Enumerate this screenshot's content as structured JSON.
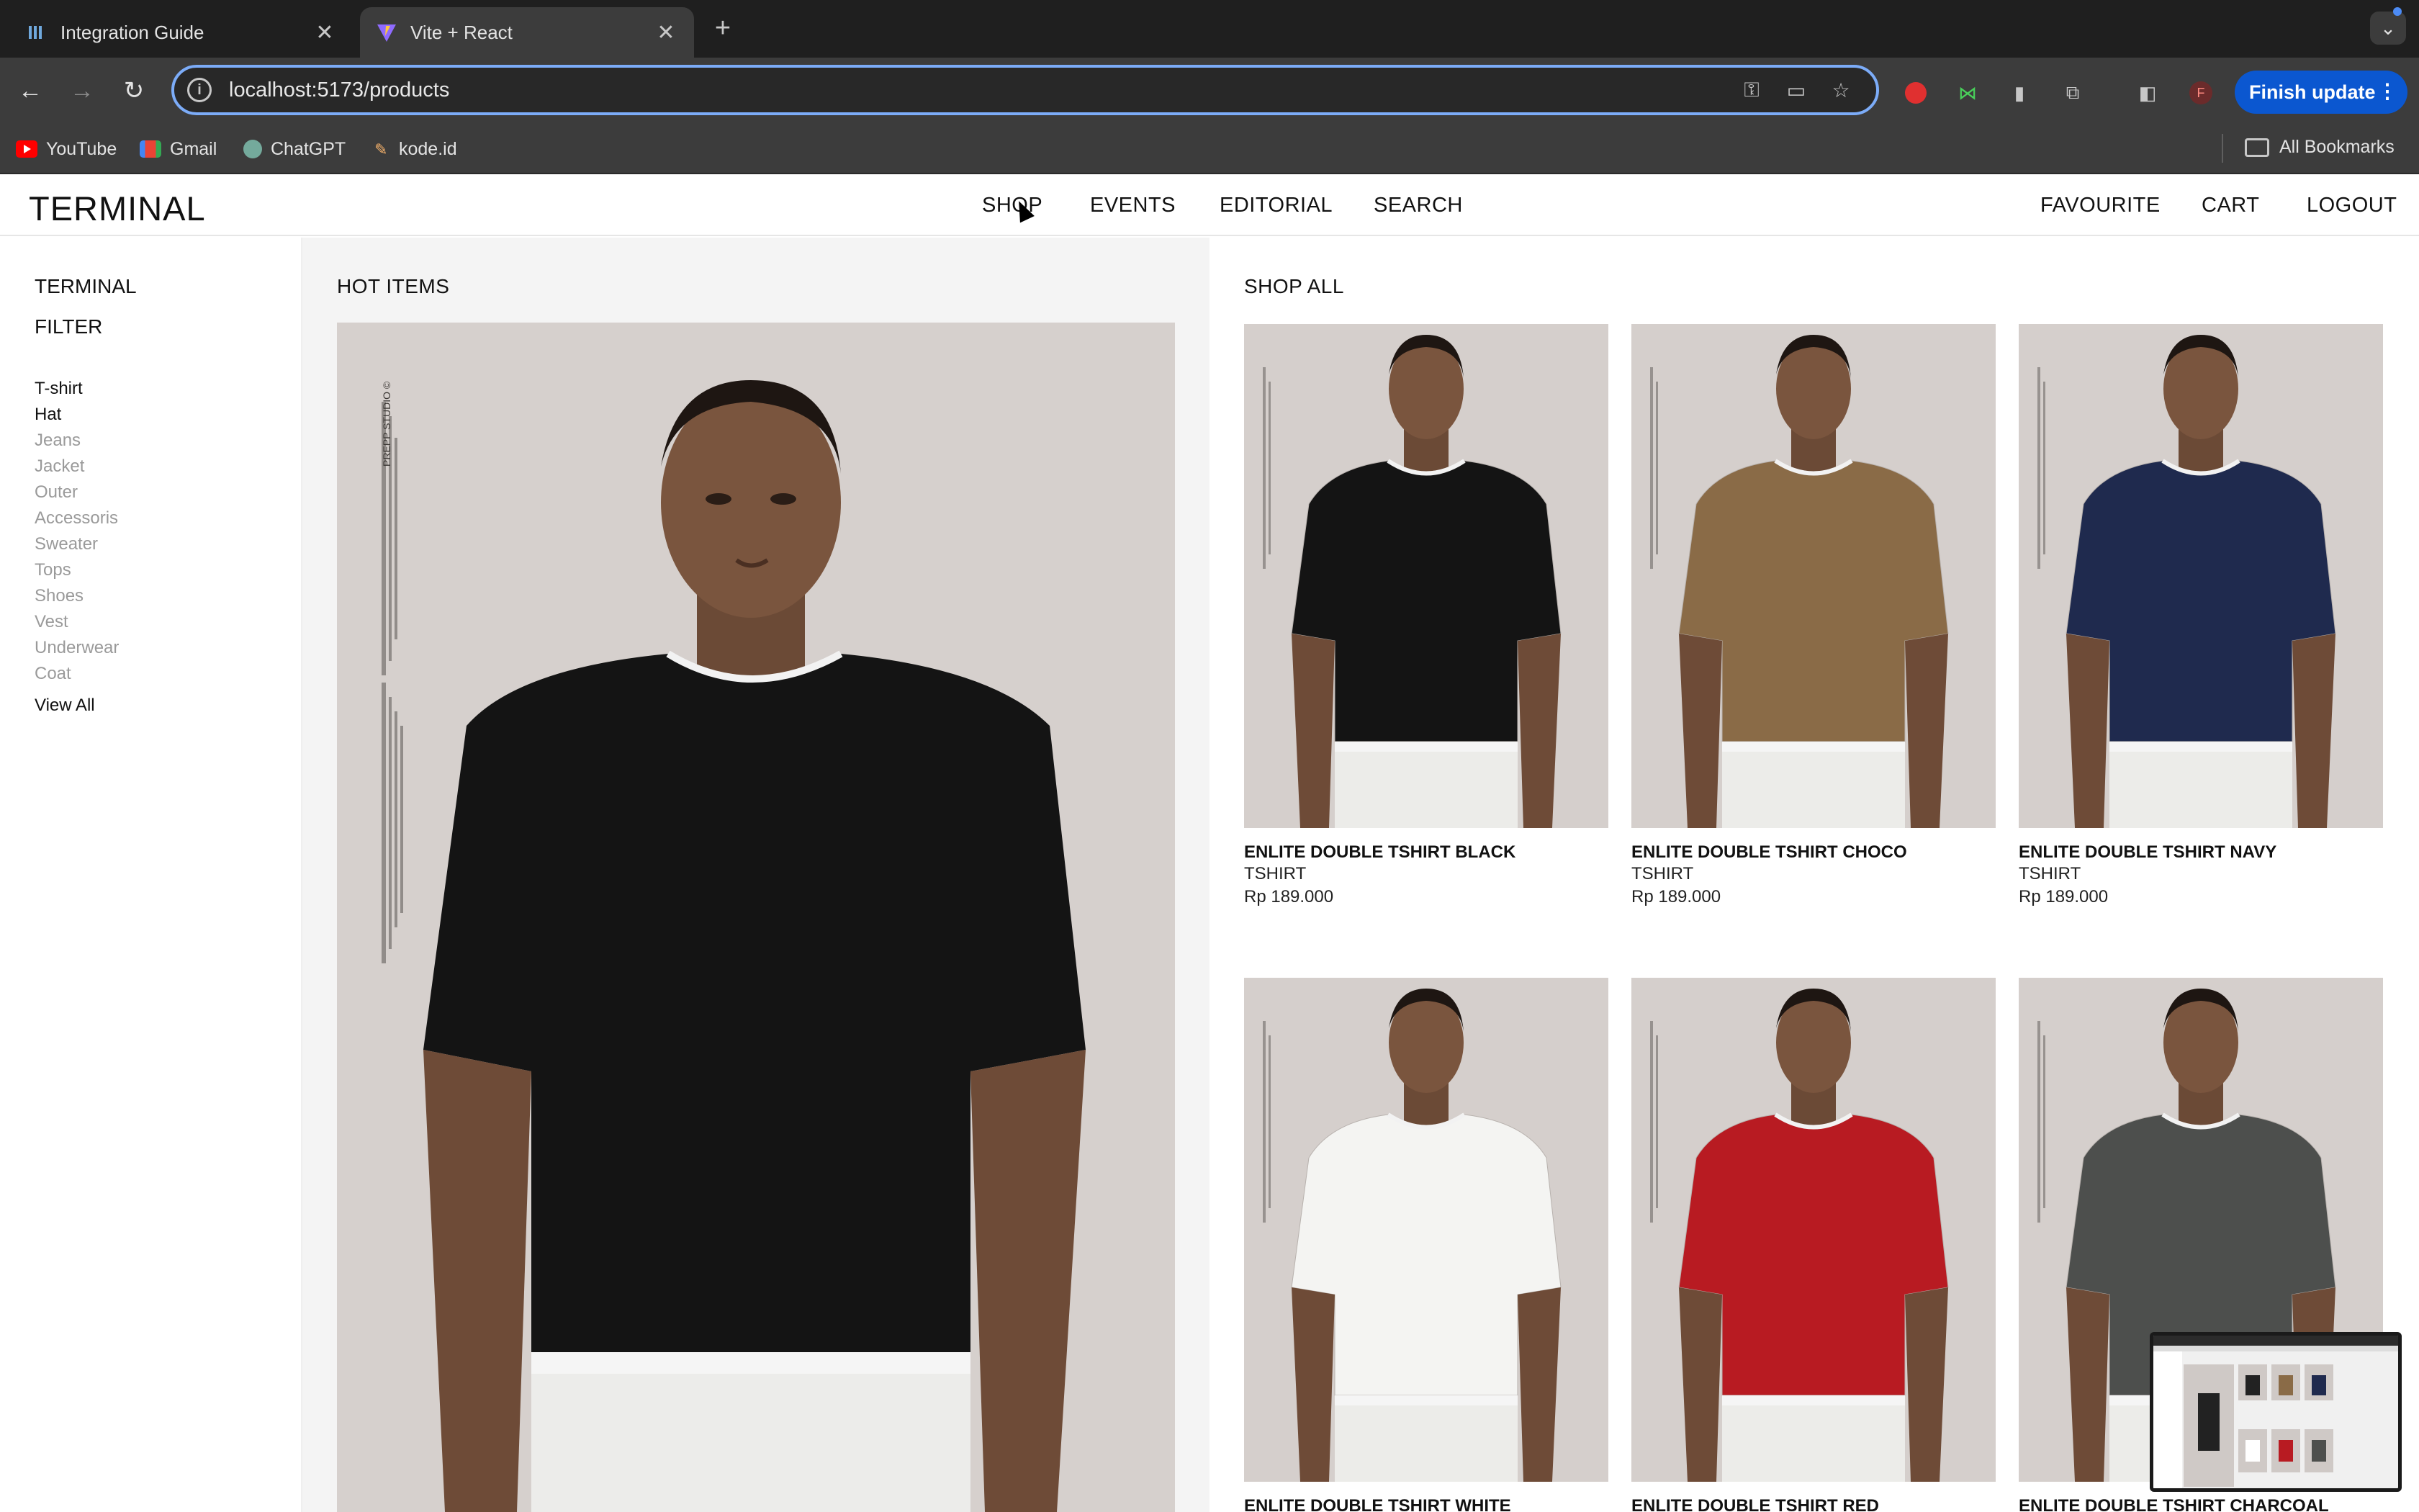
{
  "browser": {
    "tabs": [
      {
        "title": "Integration Guide",
        "active": false
      },
      {
        "title": "Vite + React",
        "active": true
      }
    ],
    "url": "localhost:5173/products",
    "finish_update": "Finish update",
    "profile_initial": "F",
    "bookmarks": [
      "YouTube",
      "Gmail",
      "ChatGPT",
      "kode.id"
    ],
    "all_bookmarks": "All Bookmarks"
  },
  "site": {
    "logo": "TERMINAL",
    "nav": [
      "SHOP",
      "EVENTS",
      "EDITORIAL",
      "SEARCH"
    ],
    "right_nav": [
      "FAVOURITE",
      "CART",
      "LOGOUT"
    ]
  },
  "sidebar": {
    "title": "TERMINAL",
    "filter_label": "FILTER",
    "categories": [
      {
        "label": "T-shirt",
        "active": true
      },
      {
        "label": "Hat",
        "active": true
      },
      {
        "label": "Jeans",
        "active": false
      },
      {
        "label": "Jacket",
        "active": false
      },
      {
        "label": "Outer",
        "active": false
      },
      {
        "label": "Accessoris",
        "active": false
      },
      {
        "label": "Sweater",
        "active": false
      },
      {
        "label": "Tops",
        "active": false
      },
      {
        "label": "Shoes",
        "active": false
      },
      {
        "label": "Vest",
        "active": false
      },
      {
        "label": "Underwear",
        "active": false
      },
      {
        "label": "Coat",
        "active": false
      }
    ],
    "view_all": "View All"
  },
  "hot_items": {
    "title": "HOT ITEMS",
    "shirt_color": "#141414",
    "brand_text": "PREPP STUDIO ©"
  },
  "shop_all": {
    "title": "SHOP ALL",
    "products": [
      {
        "name": "ENLITE DOUBLE TSHIRT BLACK",
        "category": "TSHIRT",
        "price": "Rp 189.000",
        "shirt_color": "#141414"
      },
      {
        "name": "ENLITE DOUBLE TSHIRT CHOCO",
        "category": "TSHIRT",
        "price": "Rp 189.000",
        "shirt_color": "#8a6b47"
      },
      {
        "name": "ENLITE DOUBLE TSHIRT NAVY",
        "category": "TSHIRT",
        "price": "Rp 189.000",
        "shirt_color": "#1f2a4e"
      },
      {
        "name": "ENLITE DOUBLE TSHIRT WHITE",
        "category": "",
        "price": "",
        "shirt_color": "#f4f4f2"
      },
      {
        "name": "ENLITE DOUBLE TSHIRT RED",
        "category": "",
        "price": "",
        "shirt_color": "#b81b22"
      },
      {
        "name": "ENLITE DOUBLE TSHIRT CHARCOAL",
        "category": "",
        "price": "",
        "shirt_color": "#4d4f4d"
      }
    ]
  }
}
